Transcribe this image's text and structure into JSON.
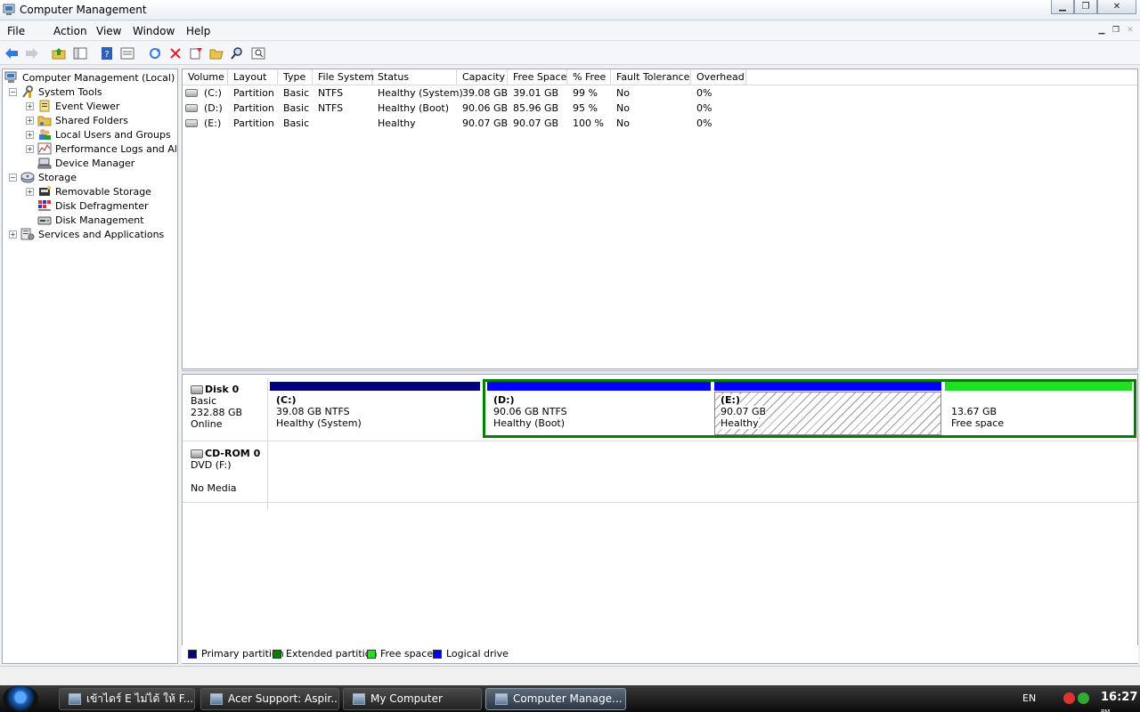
{
  "window": {
    "title": "Computer Management"
  },
  "menu": {
    "items": [
      "File",
      "Action",
      "View",
      "Window",
      "Help"
    ]
  },
  "tree": {
    "root": "Computer Management (Local)",
    "system_tools": "System Tools",
    "event_viewer": "Event Viewer",
    "shared_folders": "Shared Folders",
    "local_users": "Local Users and Groups",
    "performance": "Performance Logs and Ale",
    "device_manager": "Device Manager",
    "storage": "Storage",
    "removable_storage": "Removable Storage",
    "disk_defrag": "Disk Defragmenter",
    "disk_management": "Disk Management",
    "services": "Services and Applications"
  },
  "volume_list": {
    "columns": [
      "Volume",
      "Layout",
      "Type",
      "File System",
      "Status",
      "Capacity",
      "Free Space",
      "% Free",
      "Fault Tolerance",
      "Overhead"
    ],
    "rows": [
      [
        "(C:)",
        "Partition",
        "Basic",
        "NTFS",
        "Healthy (System)",
        "39.08 GB",
        "39.01 GB",
        "99 %",
        "No",
        "0%"
      ],
      [
        "(D:)",
        "Partition",
        "Basic",
        "NTFS",
        "Healthy (Boot)",
        "90.06 GB",
        "85.96 GB",
        "95 %",
        "No",
        "0%"
      ],
      [
        "(E:)",
        "Partition",
        "Basic",
        "",
        "Healthy",
        "90.07 GB",
        "90.07 GB",
        "100 %",
        "No",
        "0%"
      ]
    ]
  },
  "disk0": {
    "name": "Disk 0",
    "type": "Basic",
    "size": "232.88 GB",
    "state": "Online",
    "partitions": [
      {
        "label": "(C:)",
        "size": "39.08 GB NTFS",
        "status": "Healthy (System)"
      },
      {
        "label": "(D:)",
        "size": "90.06 GB NTFS",
        "status": "Healthy (Boot)"
      },
      {
        "label": "(E:)",
        "size": "90.07 GB",
        "status": "Healthy"
      },
      {
        "label": "",
        "size": "13.67 GB",
        "status": "Free space"
      }
    ]
  },
  "cdrom0": {
    "name": "CD-ROM 0",
    "drive": "DVD (F:)",
    "state": "No Media"
  },
  "legend": {
    "primary": "Primary partition",
    "extended": "Extended partition",
    "free": "Free space",
    "logical": "Logical drive"
  },
  "colors": {
    "primary": "#000080",
    "extended": "#008000",
    "free": "#20e020",
    "logical": "#0000ff"
  },
  "taskbar": {
    "tasks": [
      "เข้าไดร์ E ไม่ได้ ให้ F...",
      "Acer Support: Aspir...",
      "My Computer",
      "Computer Manage..."
    ],
    "lang": "EN",
    "clock_time": "16:27",
    "clock_ampm": "PM"
  }
}
